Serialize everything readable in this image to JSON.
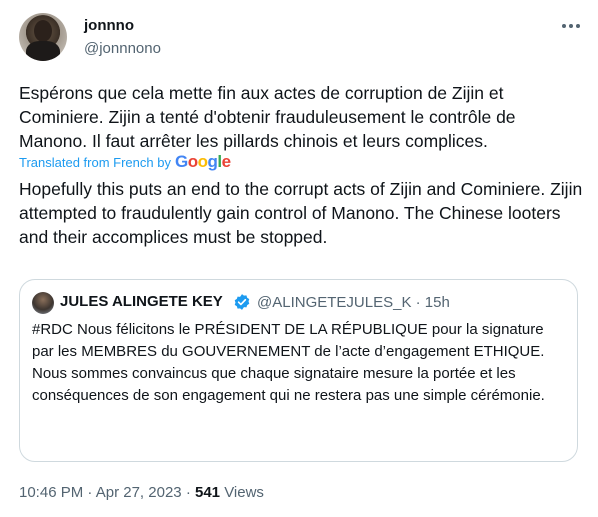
{
  "author": {
    "display_name": "jonnno",
    "handle": "@jonnnono"
  },
  "tweet": {
    "text": "Espérons que cela mette fin aux actes de corruption de Zijin et Cominiere. Zijin a tenté d'obtenir frauduleusement le contrôle de Manono. Il faut arrêter les pillards chinois et leurs complices.",
    "translated_label": "Translated from French by",
    "translator": "Google",
    "translation": "Hopefully this puts an end to the corrupt acts of Zijin and Cominiere. Zijin attempted to fraudulently gain control of Manono. The Chinese looters and their accomplices must be stopped."
  },
  "quote": {
    "display_name": "JULES ALINGETE KEY",
    "verified_icon": "verified-badge-icon",
    "handle": "@ALINGETEJULES_K",
    "separator": "·",
    "time": "15h",
    "text": "#RDC Nous félicitons le PRÉSIDENT DE LA RÉPUBLIQUE pour la signature par les MEMBRES du GOUVERNEMENT de l’acte d’engagement  ETHIQUE.\nNous sommes convaincus que chaque signataire mesure la portée et les conséquences de son engagement qui ne restera pas une simple cérémonie."
  },
  "footer": {
    "time": "10:46 PM",
    "dot1": "·",
    "date": "Apr 27, 2023",
    "dot2": "·",
    "views_count": "541",
    "views_label": "Views"
  },
  "colors": {
    "accent": "#1d9bf0",
    "muted": "#536471",
    "text": "#0f1419",
    "border": "#cfd9de"
  }
}
